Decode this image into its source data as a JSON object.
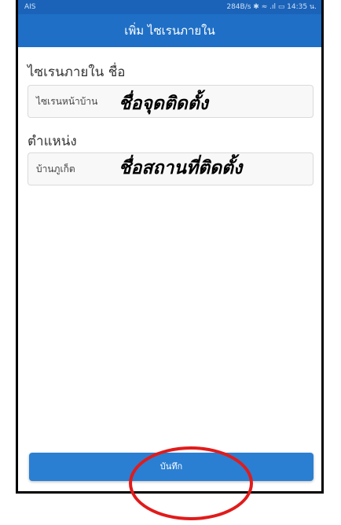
{
  "status_bar": {
    "carrier": "AIS",
    "right_info": "284B/s ✱ ≈ .ıl ▭ 14:35 น."
  },
  "app_bar": {
    "title": "เพิ่ม ไซเรนภายใน"
  },
  "form": {
    "name_label": "ไซเรนภายใน ชื่อ",
    "name_value": "ไซเรนหน้าบ้าน",
    "location_label": "ตำแหน่ง",
    "location_value": "บ้านภูเก็ต"
  },
  "annotations": {
    "name_overlay": "ชื่อจุดติดตั้ง",
    "location_overlay": "ชื่อสถานที่ติดตั้ง",
    "circle_color": "#e11b1b"
  },
  "actions": {
    "save_label": "บันทึก"
  },
  "colors": {
    "status_bar": "#1b63b8",
    "app_bar": "#1f6fc6",
    "button": "#2a7fd2"
  }
}
